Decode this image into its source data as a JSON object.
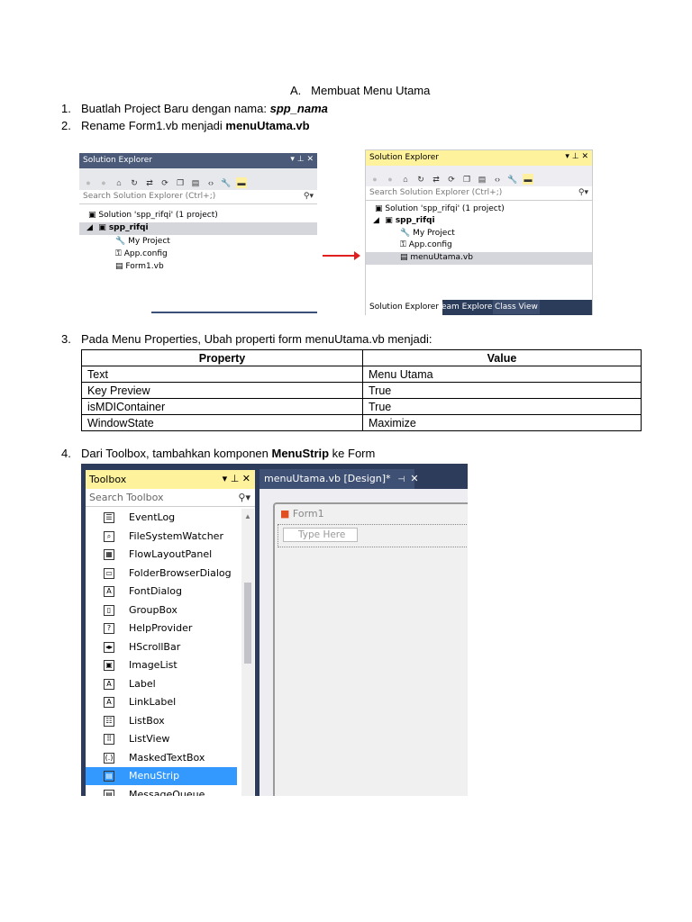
{
  "heading": {
    "letter": "A.",
    "title": "Membuat Menu Utama"
  },
  "steps": [
    {
      "num": "1.",
      "text": "Buatlah Project Baru dengan nama: ",
      "bold": "spp_nama"
    },
    {
      "num": "2.",
      "text": "Rename Form1.vb menjadi ",
      "bold": "menuUtama.vb"
    },
    {
      "num": "3.",
      "text": "Pada Menu Properties, Ubah properti form menuUtama.vb menjadi:"
    },
    {
      "num": "4.",
      "text": "Dari Toolbox, tambahkan komponen ",
      "bold": "MenuStrip",
      "tail": " ke Form"
    }
  ],
  "se1": {
    "title": "Solution Explorer",
    "search": "Search Solution Explorer (Ctrl+;)",
    "solution": "Solution 'spp_rifqi' (1 project)",
    "project": "spp_rifqi",
    "items": [
      "My Project",
      "App.config",
      "Form1.vb"
    ]
  },
  "se2": {
    "title": "Solution Explorer",
    "search": "Search Solution Explorer (Ctrl+;)",
    "solution": "Solution 'spp_rifqi' (1 project)",
    "project": "spp_rifqi",
    "items": [
      "My Project",
      "App.config",
      "menuUtama.vb"
    ],
    "tabs": [
      "Solution Explorer",
      "Team Explorer",
      "Class View"
    ]
  },
  "table": {
    "headers": [
      "Property",
      "Value"
    ],
    "rows": [
      [
        "Text",
        "Menu Utama"
      ],
      [
        "Key Preview",
        "True"
      ],
      [
        "isMDIContainer",
        "True"
      ],
      [
        "WindowState",
        "Maximize"
      ]
    ]
  },
  "toolbox": {
    "title": "Toolbox",
    "search": "Search Toolbox",
    "items": [
      "EventLog",
      "FileSystemWatcher",
      "FlowLayoutPanel",
      "FolderBrowserDialog",
      "FontDialog",
      "GroupBox",
      "HelpProvider",
      "HScrollBar",
      "ImageList",
      "Label",
      "LinkLabel",
      "ListBox",
      "ListView",
      "MaskedTextBox",
      "MenuStrip",
      "MessageQueue"
    ],
    "selected": "MenuStrip"
  },
  "designer": {
    "tab": "menuUtama.vb [Design]*",
    "form_title": "Form1",
    "type_here": "Type Here"
  }
}
